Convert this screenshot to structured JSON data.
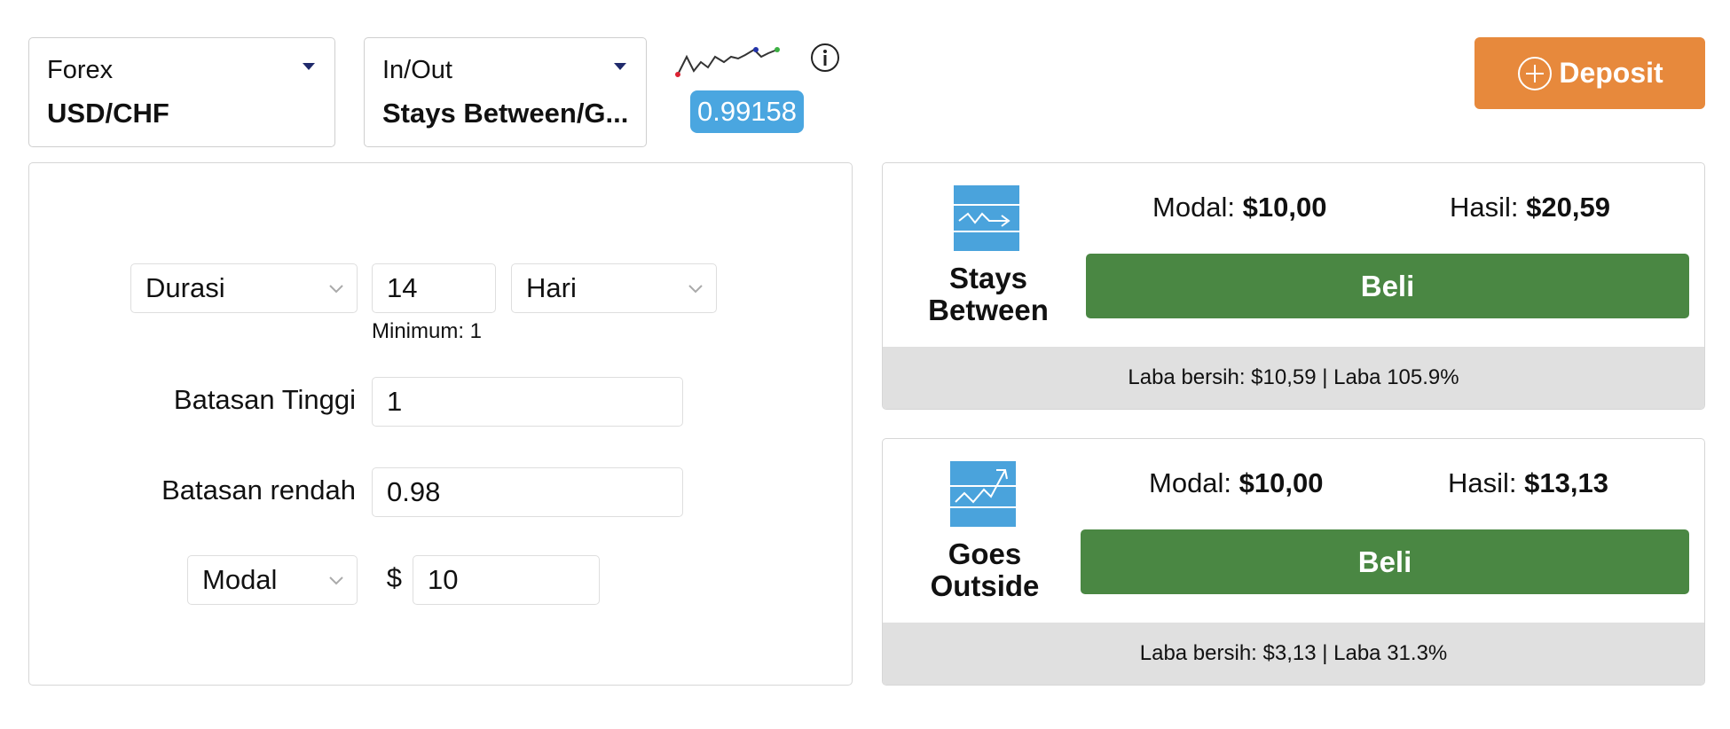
{
  "asset_selector": {
    "label": "Forex",
    "value": "USD/CHF"
  },
  "type_selector": {
    "label": "In/Out",
    "value": "Stays Between/G..."
  },
  "price": {
    "value": "0.99158",
    "sparkline_icon": "sparkline-chart",
    "info_icon": "info-circle"
  },
  "deposit": {
    "label": "Deposit",
    "icon": "plus-circle-icon"
  },
  "form": {
    "duration_select": "Durasi",
    "duration_value": "14",
    "duration_unit": "Hari",
    "minimum_hint": "Minimum: 1",
    "upper_label": "Batasan Tinggi",
    "upper_value": "1",
    "lower_label": "Batasan rendah",
    "lower_value": "0.98",
    "amount_select": "Modal",
    "currency_symbol": "$",
    "amount_value": "10"
  },
  "cards": [
    {
      "title_line1": "Stays",
      "title_line2": "Between",
      "modal_label": "Modal:",
      "modal_value": "$10,00",
      "hasil_label": "Hasil:",
      "hasil_value": "$20,59",
      "buy_label": "Beli",
      "footer": "Laba bersih: $10,59 | Laba 105.9%",
      "icon": "stays-between-icon"
    },
    {
      "title_line1": "Goes",
      "title_line2": "Outside",
      "modal_label": "Modal:",
      "modal_value": "$10,00",
      "hasil_label": "Hasil:",
      "hasil_value": "$13,13",
      "buy_label": "Beli",
      "footer": "Laba bersih: $3,13 | Laba 31.3%",
      "icon": "goes-outside-icon"
    }
  ],
  "colors": {
    "deposit": "#e7893c",
    "buy": "#4a8743",
    "price_badge": "#4aa6e0",
    "card_icon": "#4aa3dc",
    "footer_bg": "#e0e0e0"
  }
}
